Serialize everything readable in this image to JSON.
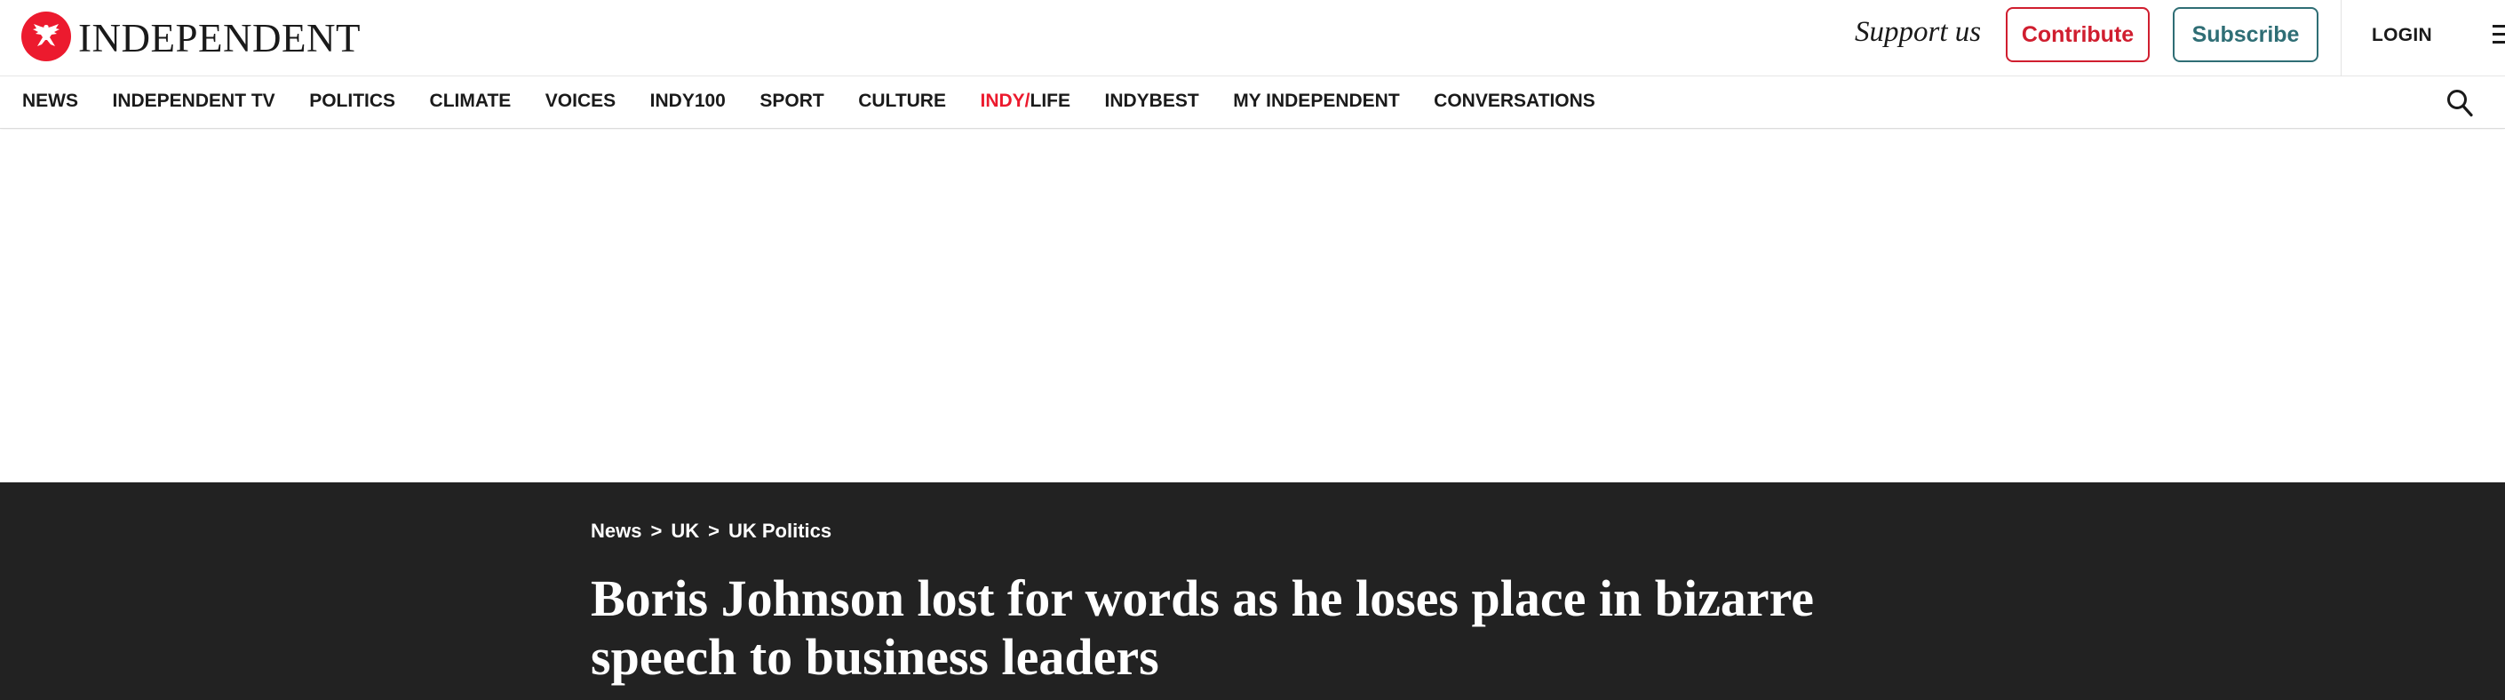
{
  "brand": {
    "name": "INDEPENDENT",
    "accent_color": "#ec1a2e"
  },
  "header": {
    "support_label": "Support us",
    "contribute_label": "Contribute",
    "subscribe_label": "Subscribe",
    "login_label": "LOGIN",
    "contribute_color": "#d01e2f",
    "subscribe_color": "#2f6e75"
  },
  "nav": {
    "items": [
      {
        "label": "NEWS"
      },
      {
        "label": "INDEPENDENT TV"
      },
      {
        "label": "POLITICS"
      },
      {
        "label": "CLIMATE"
      },
      {
        "label": "VOICES"
      },
      {
        "label": "INDY100"
      },
      {
        "label": "SPORT"
      },
      {
        "label": "CULTURE"
      },
      {
        "label_prefix": "INDY/",
        "label_suffix": "LIFE"
      },
      {
        "label": "INDYBEST"
      },
      {
        "label": "MY INDEPENDENT"
      },
      {
        "label": "CONVERSATIONS"
      }
    ],
    "icons": {
      "search": "search-icon",
      "menu": "hamburger-menu-icon"
    }
  },
  "article": {
    "band_color": "#222222",
    "breadcrumb": [
      "News",
      "UK",
      "UK Politics"
    ],
    "breadcrumb_separator": ">",
    "headline": "Boris Johnson lost for words as he loses place in bizarre speech to business leaders"
  }
}
